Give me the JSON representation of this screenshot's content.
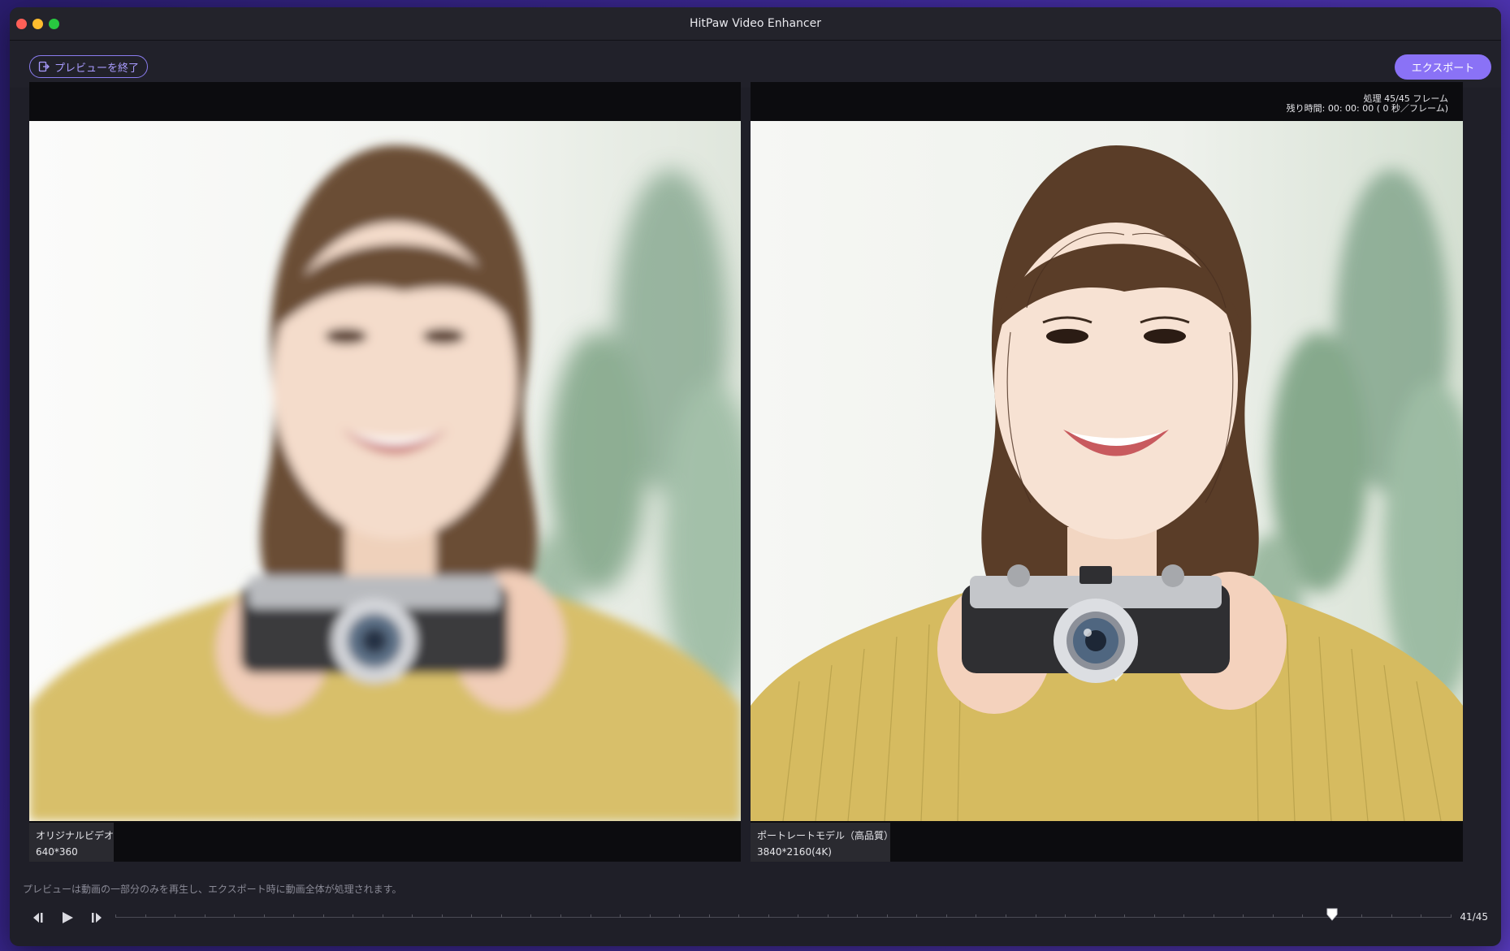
{
  "window": {
    "title": "HitPaw Video Enhancer"
  },
  "toolbar": {
    "exit_preview_label": "プレビューを終了",
    "export_label": "エクスポート"
  },
  "original": {
    "name": "オリジナルビデオ",
    "resolution": "640*360"
  },
  "enhanced": {
    "name": "ポートレートモデル（高品質）",
    "resolution": "3840*2160(4K)",
    "processing": "処理 45/45 フレーム",
    "remaining": "残り時間: 00: 00: 00 ( 0 秒／フレーム)"
  },
  "notice": "プレビューは動画の一部分のみを再生し、エクスポート時に動画全体が処理されます。",
  "playback": {
    "current_frame": 41,
    "total_frames": 45,
    "frame_label": "41/45"
  },
  "colors": {
    "accent": "#8a72f6",
    "sweater": "#d8bf6a",
    "background_plant": "#6f9a78"
  },
  "icons": {
    "exit": "exit-icon",
    "prev": "step-back-icon",
    "play": "play-icon",
    "next": "step-forward-icon"
  }
}
